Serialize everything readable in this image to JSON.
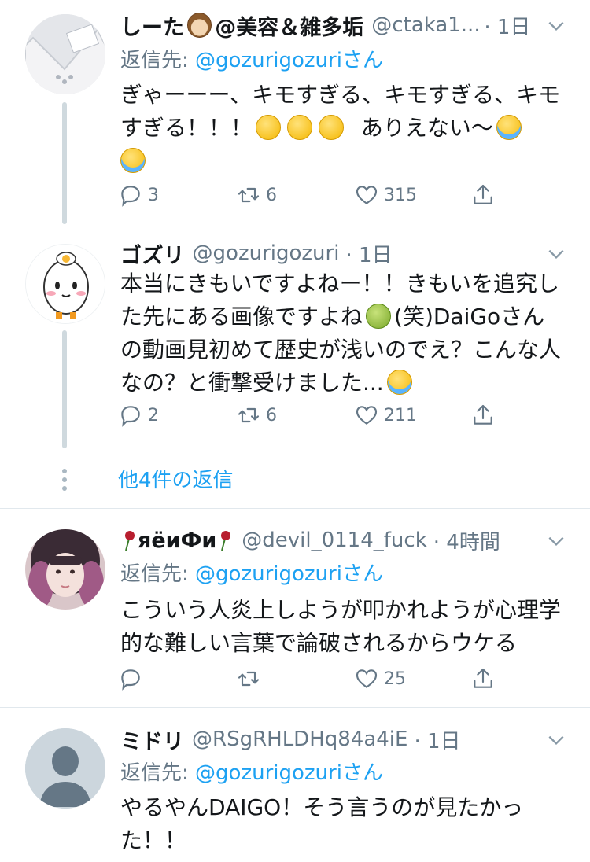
{
  "tweets": [
    {
      "display_name": "しーた",
      "name_suffix": "@美容＆雑多垢",
      "handle": "@ctaka1...",
      "time": "· 1日",
      "reply_prefix": "返信先: ",
      "reply_handle": "@gozurigozuri",
      "reply_suffix": "さん",
      "text_lines": [
        "ぎゃーーー、キモすぎる、キモすぎる、キモ",
        "すぎる！！！",
        "ありえない〜"
      ],
      "replies": "3",
      "retweets": "6",
      "likes": "315"
    },
    {
      "display_name": "ゴズリ",
      "handle": "@gozurigozuri",
      "time": "· 1日",
      "text_lines": [
        "本当にきもいですよねー！！きもいを追究し",
        "た先にある画像ですよね",
        "(笑)DaiGoさん",
        "の動画見初めて歴史が浅いのでえ？こんな人",
        "なの？と衝撃受けました..."
      ],
      "replies": "2",
      "retweets": "6",
      "likes": "211"
    },
    {
      "display_name": "яёиФи",
      "handle": "@devil_0114_fuck",
      "time": "· 4時間",
      "reply_prefix": "返信先: ",
      "reply_handle": "@gozurigozuri",
      "reply_suffix": "さん",
      "text_lines": [
        "こういう人炎上しようが叩かれようが心理学",
        "的な難しい言葉で論破されるからウケる"
      ],
      "replies": "",
      "retweets": "",
      "likes": "25"
    },
    {
      "display_name": "ミドリ",
      "handle": "@RSgRHLDHq84a4iE",
      "time": "· 1日",
      "reply_prefix": "返信先: ",
      "reply_handle": "@gozurigozuri",
      "reply_suffix": "さん",
      "text_lines": [
        "やるやんDAIGO！そう言うのが見たかっ",
        "た！！"
      ]
    }
  ],
  "more_replies_label": "他4件の返信",
  "icons": {
    "reply": "reply-icon",
    "retweet": "retweet-icon",
    "like": "heart-icon",
    "share": "share-icon",
    "menu": "chevron-down-icon"
  },
  "colors": {
    "link": "#1da1f2",
    "secondary_text": "#657786",
    "primary_text": "#14171a",
    "divider": "#e1e8ed"
  }
}
